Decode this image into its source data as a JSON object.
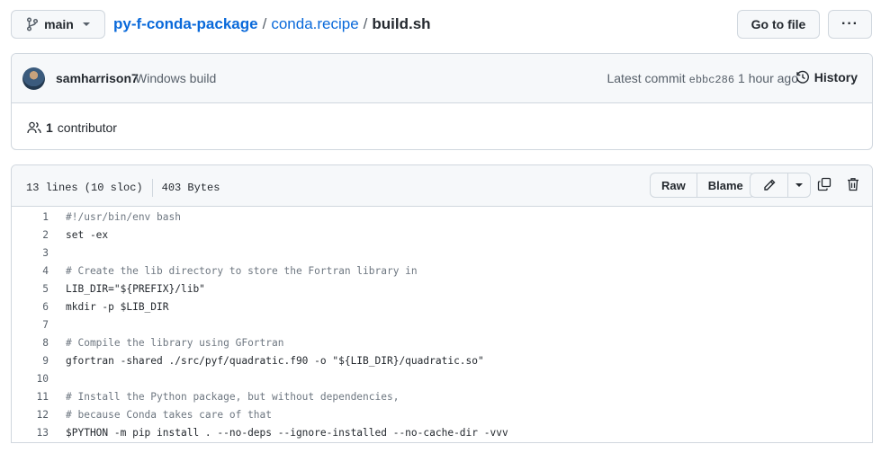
{
  "header": {
    "branch": "main",
    "breadcrumb": {
      "repo": "py-f-conda-package",
      "folder": "conda.recipe",
      "sep1": "/",
      "sep2": "/",
      "file": "build.sh"
    },
    "goto_file_label": "Go to file",
    "more_label": "···"
  },
  "commit": {
    "author": "samharrison7",
    "message": "Windows build",
    "latest_label": "Latest commit",
    "sha": "ebbc286",
    "time": "1 hour ago",
    "history_label": "History"
  },
  "contributors": {
    "count": "1",
    "label": "contributor"
  },
  "file": {
    "lines_info": "13 lines (10 sloc)",
    "size": "403 Bytes",
    "raw_label": "Raw",
    "blame_label": "Blame",
    "code_lines": [
      {
        "num": "1",
        "text": "#!/usr/bin/env bash"
      },
      {
        "num": "2",
        "text": "set -ex"
      },
      {
        "num": "3",
        "text": ""
      },
      {
        "num": "4",
        "text": "# Create the lib directory to store the Fortran library in"
      },
      {
        "num": "5",
        "text": "LIB_DIR=\"${PREFIX}/lib\""
      },
      {
        "num": "6",
        "text": "mkdir -p $LIB_DIR"
      },
      {
        "num": "7",
        "text": ""
      },
      {
        "num": "8",
        "text": "# Compile the library using GFortran"
      },
      {
        "num": "9",
        "text": "gfortran -shared ./src/pyf/quadratic.f90 -o \"${LIB_DIR}/quadratic.so\""
      },
      {
        "num": "10",
        "text": ""
      },
      {
        "num": "11",
        "text": "# Install the Python package, but without dependencies,"
      },
      {
        "num": "12",
        "text": "# because Conda takes care of that"
      },
      {
        "num": "13",
        "text": "$PYTHON -m pip install . --no-deps --ignore-installed --no-cache-dir -vvv"
      }
    ]
  },
  "icons": {
    "branch": "git-branch-icon",
    "history": "history-clock-icon",
    "people": "people-icon",
    "pencil": "pencil-icon",
    "copy": "copy-icon",
    "trash": "trash-icon"
  },
  "colors": {
    "link": "#0969da",
    "border": "#d0d7de",
    "header_bg": "#f6f8fa",
    "muted": "#57606a"
  }
}
